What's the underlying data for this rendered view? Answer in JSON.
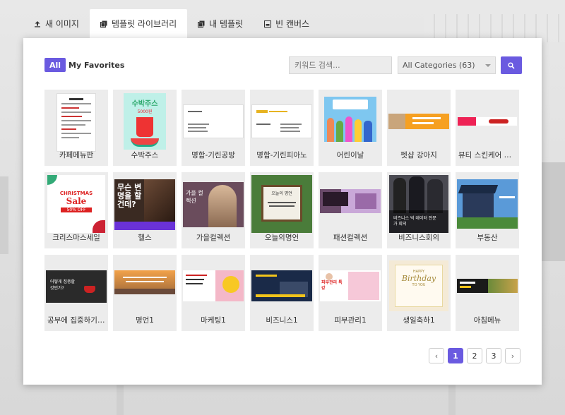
{
  "tabs": [
    {
      "label": "새 이미지",
      "icon": "upload-icon"
    },
    {
      "label": "템플릿 라이브러리",
      "icon": "templates-icon"
    },
    {
      "label": "내 템플릿",
      "icon": "my-templates-icon"
    },
    {
      "label": "빈 캔버스",
      "icon": "blank-canvas-icon"
    }
  ],
  "filters": {
    "all_label": "All",
    "favorites_label": "My Favorites"
  },
  "search": {
    "placeholder": "키워드 검색..."
  },
  "category": {
    "selected": "All Categories (63)"
  },
  "templates": [
    {
      "label": "카페메뉴판"
    },
    {
      "label": "수박주스"
    },
    {
      "label": "명함-기린공방"
    },
    {
      "label": "명함-기린피아노"
    },
    {
      "label": "어린이날"
    },
    {
      "label": "펫샵 강아지"
    },
    {
      "label": "뷰티 스킨케어 상..."
    },
    {
      "label": "크리스마스세일"
    },
    {
      "label": "헬스"
    },
    {
      "label": "가을컬렉션"
    },
    {
      "label": "오늘의명언"
    },
    {
      "label": "패션컬렉션"
    },
    {
      "label": "비즈니스회의"
    },
    {
      "label": "부동산"
    },
    {
      "label": "공부에 집중하기 ..."
    },
    {
      "label": "명언1"
    },
    {
      "label": "마케팅1"
    },
    {
      "label": "비즈니스1"
    },
    {
      "label": "피부관리1"
    },
    {
      "label": "생일축하1"
    },
    {
      "label": "아침메뉴"
    }
  ],
  "thumb_text": {
    "watermelon": "수박주스",
    "watermelon_price": "5000원",
    "christmas": "CHRISTMAS",
    "christmas_sale": "Sale",
    "christmas_off": "50% OFF",
    "fitness": "무슨 변명을 할건데?",
    "autumn": "가을 컬렉션",
    "quote": "오늘의 명언",
    "business": "비즈니스 빅 데이터 전문가 회의",
    "study": "어떻게 집중할것인가?",
    "birthday_happy": "HAPPY",
    "birthday": "Birthday",
    "birthday_to": "TO YOU",
    "skincare": "피부관리 특강"
  },
  "pagination": {
    "prev": "‹",
    "pages": [
      "1",
      "2",
      "3"
    ],
    "active": "1",
    "next": "›"
  },
  "colors": {
    "accent": "#6a5ae0",
    "tile_bg": "#ececec"
  }
}
